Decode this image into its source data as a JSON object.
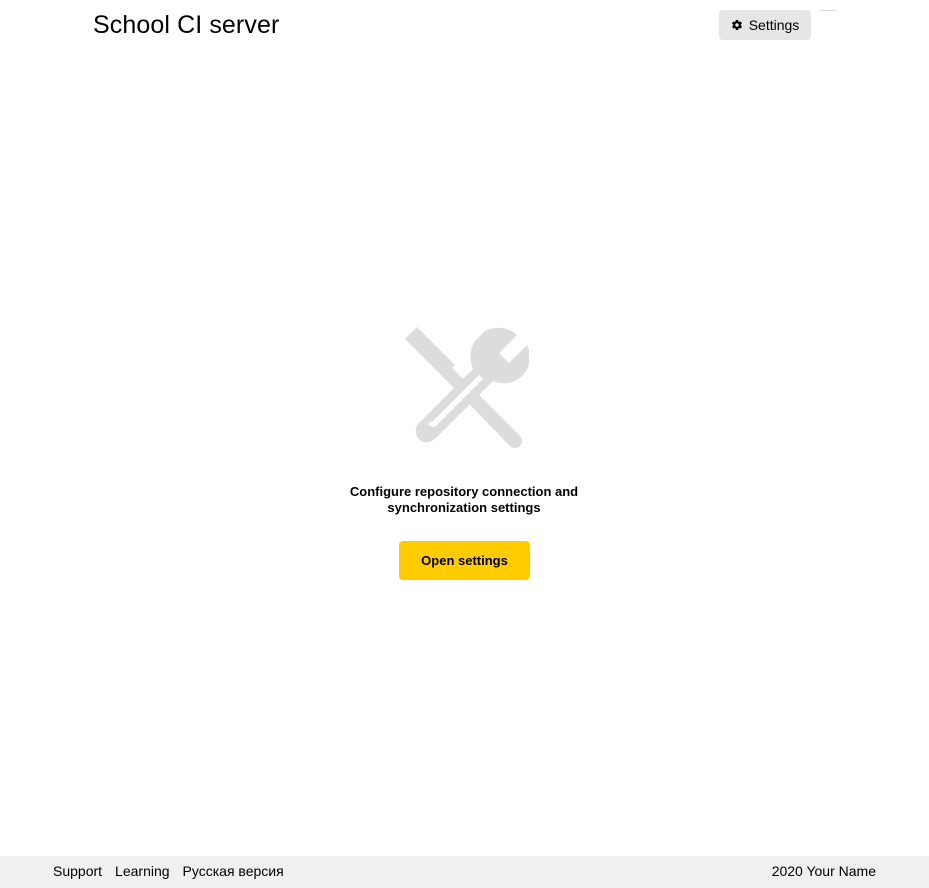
{
  "header": {
    "title": "School CI server",
    "settings_button": {
      "label": "Settings",
      "icon": "gear-icon"
    }
  },
  "main": {
    "icon": "tools-icon",
    "message": "Configure repository connection and synchronization settings",
    "open_settings_button": "Open settings"
  },
  "footer": {
    "links": [
      "Support",
      "Learning",
      "Русская версия"
    ],
    "copyright": "2020 Your Name"
  },
  "colors": {
    "accent": "#ffcc00",
    "button_secondary": "#e6e6e6",
    "footer_bg": "#f0f0f0",
    "icon_gray": "#dcdcdc"
  }
}
